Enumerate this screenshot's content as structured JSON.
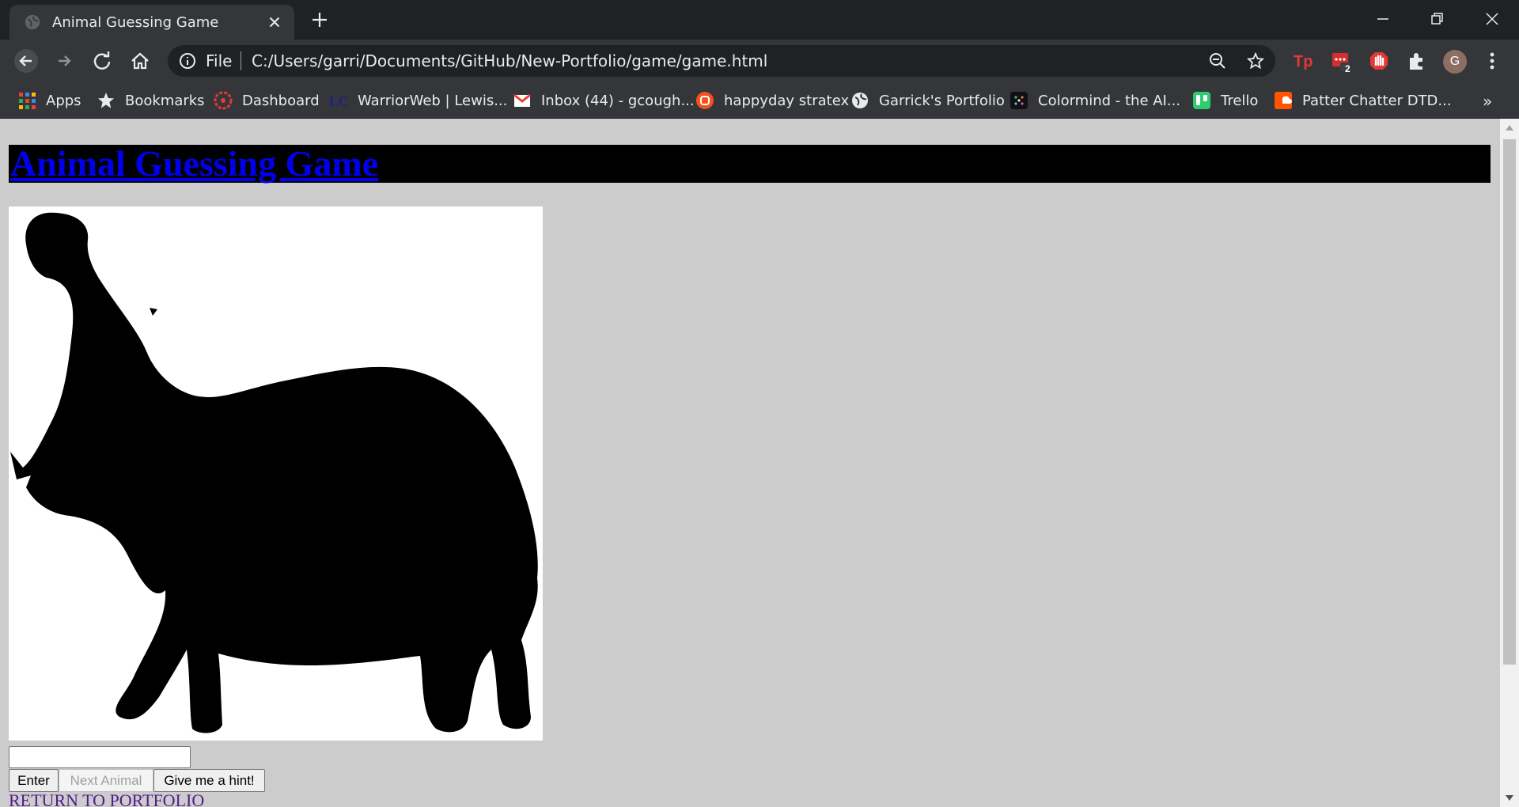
{
  "browser": {
    "tab": {
      "title": "Animal Guessing Game",
      "favicon": "globe-icon"
    },
    "address": {
      "scheme_label": "File",
      "url": "C:/Users/garri/Documents/GitHub/New-Portfolio/game/game.html"
    },
    "profile_initial": "G",
    "extension_badge": "2",
    "bookmarks": [
      {
        "label": "Apps",
        "icon": "apps-grid-icon"
      },
      {
        "label": "Bookmarks",
        "icon": "star-icon"
      },
      {
        "label": "Dashboard",
        "icon": "dashboard-icon"
      },
      {
        "label": "WarriorWeb | Lewis...",
        "icon": "warriorweb-icon"
      },
      {
        "label": "Inbox (44) - gcough...",
        "icon": "gmail-icon"
      },
      {
        "label": "happyday stratex",
        "icon": "happyday-icon"
      },
      {
        "label": "Garrick's Portfolio",
        "icon": "globe-icon"
      },
      {
        "label": "Colormind - the AI...",
        "icon": "colormind-icon"
      },
      {
        "label": "Trello",
        "icon": "trello-icon"
      },
      {
        "label": "Patter Chatter DTD...",
        "icon": "soundcloud-icon"
      }
    ],
    "more_bookmarks": "»"
  },
  "page": {
    "title": "Animal Guessing Game",
    "image": {
      "animal": "hippopotamus silhouette",
      "icon": "hippo-silhouette"
    },
    "guess_input": {
      "value": "",
      "placeholder": ""
    },
    "buttons": {
      "enter": "Enter",
      "next_animal": "Next Animal",
      "hint": "Give me a hint!"
    },
    "return_link": "RETURN TO PORTFOLIO"
  },
  "colors": {
    "page_bg": "#cccccc",
    "title_link": "#0000ee",
    "visited_link": "#551a8b",
    "header_bg": "#000000",
    "chrome_dark": "#202124",
    "chrome_toolbar": "#35363a"
  }
}
